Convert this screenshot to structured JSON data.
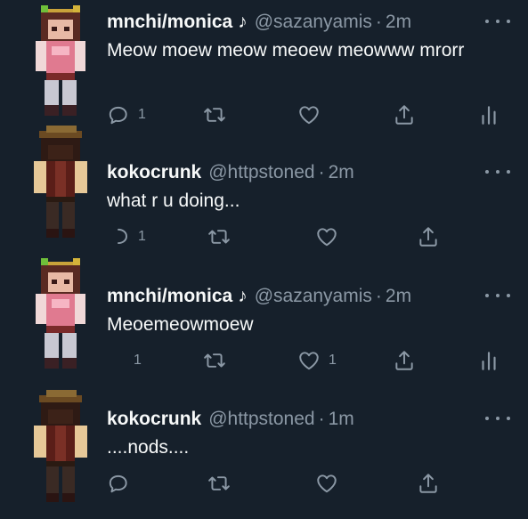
{
  "tweets": [
    {
      "name": "mnchi/monica",
      "name_suffix": "♪",
      "handle": "@sazanyamis",
      "separator": "·",
      "time": "2m",
      "text": "Meow moew meow meoew meowww mrorr",
      "reply_count": "1",
      "like_count": "",
      "avatar": "minecraft-pink-skin"
    },
    {
      "name": "kokocrunk",
      "name_suffix": "",
      "handle": "@httpstoned",
      "separator": "·",
      "time": "2m",
      "text": "what r u doing...",
      "reply_count": "1",
      "like_count": "",
      "avatar": "minecraft-brown-skin"
    },
    {
      "name": "mnchi/monica",
      "name_suffix": "♪",
      "handle": "@sazanyamis",
      "separator": "·",
      "time": "2m",
      "text": "Meoemeowmoew",
      "reply_count": "1",
      "like_count": "1",
      "avatar": "minecraft-pink-skin"
    },
    {
      "name": "kokocrunk",
      "name_suffix": "",
      "handle": "@httpstoned",
      "separator": "·",
      "time": "1m",
      "text": "....nods....",
      "reply_count": "",
      "like_count": "",
      "avatar": "minecraft-brown-skin"
    }
  ],
  "colors": {
    "background": "#16202b",
    "text_primary": "#f7f9f9",
    "text_secondary": "#8b98a5"
  }
}
